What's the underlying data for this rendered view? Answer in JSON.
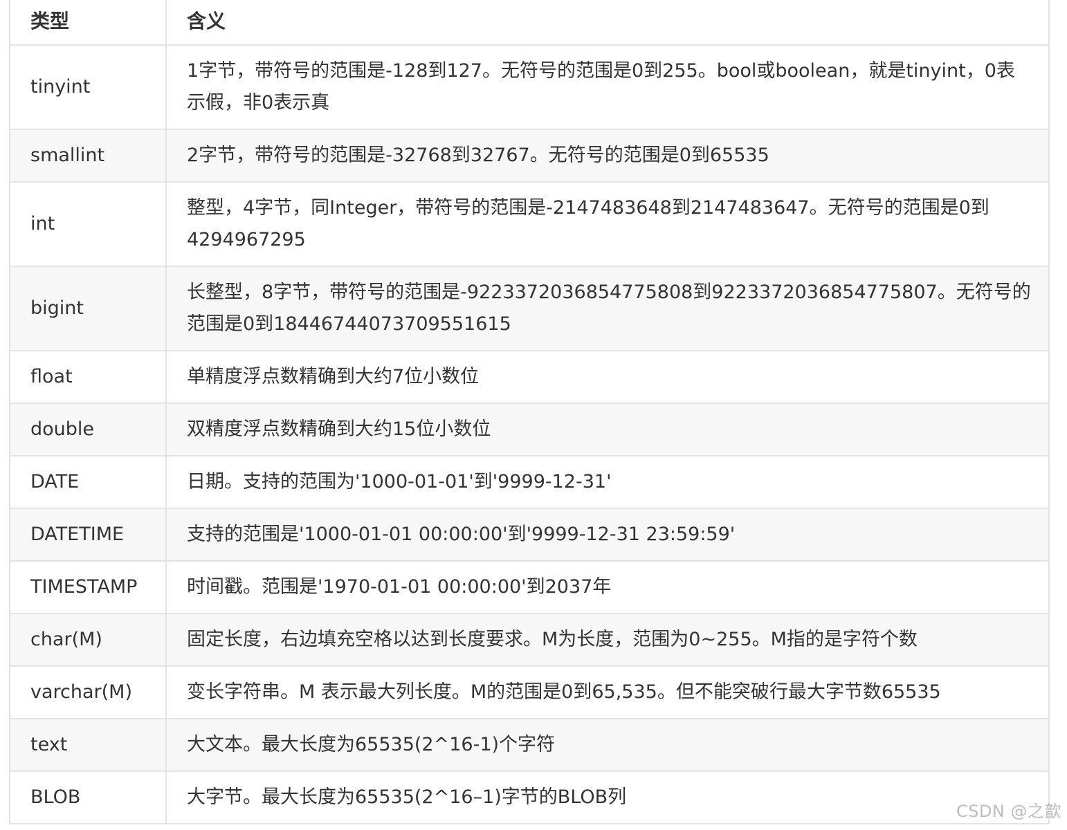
{
  "table": {
    "headers": [
      "类型",
      "含义"
    ],
    "rows": [
      {
        "type": "tinyint",
        "meaning": "1字节，带符号的范围是-128到127。无符号的范围是0到255。bool或boolean，就是tinyint，0表示假，非0表示真"
      },
      {
        "type": "smallint",
        "meaning": "2字节，带符号的范围是-32768到32767。无符号的范围是0到65535"
      },
      {
        "type": "int",
        "meaning": "整型，4字节，同Integer，带符号的范围是-2147483648到2147483647。无符号的范围是0到4294967295"
      },
      {
        "type": "bigint",
        "meaning": "长整型，8字节，带符号的范围是-9223372036854775808到9223372036854775807。无符号的范围是0到18446744073709551615"
      },
      {
        "type": "float",
        "meaning": "单精度浮点数精确到大约7位小数位"
      },
      {
        "type": "double",
        "meaning": "双精度浮点数精确到大约15位小数位"
      },
      {
        "type": "DATE",
        "meaning": "日期。支持的范围为'1000-01-01'到'9999-12-31'"
      },
      {
        "type": "DATETIME",
        "meaning": "支持的范围是'1000-01-01 00:00:00'到'9999-12-31 23:59:59'"
      },
      {
        "type": "TIMESTAMP",
        "meaning": "时间戳。范围是'1970-01-01 00:00:00'到2037年"
      },
      {
        "type": "char(M)",
        "meaning": "固定长度，右边填充空格以达到长度要求。M为长度，范围为0~255。M指的是字符个数"
      },
      {
        "type": "varchar(M)",
        "meaning": "变长字符串。M 表示最大列长度。M的范围是0到65,535。但不能突破行最大字节数65535"
      },
      {
        "type": "text",
        "meaning": "大文本。最大长度为65535(2^16-1)个字符"
      },
      {
        "type": "BLOB",
        "meaning": "大字节。最大长度为65535(2^16–1)字节的BLOB列"
      }
    ]
  },
  "watermark": "CSDN @之歆"
}
